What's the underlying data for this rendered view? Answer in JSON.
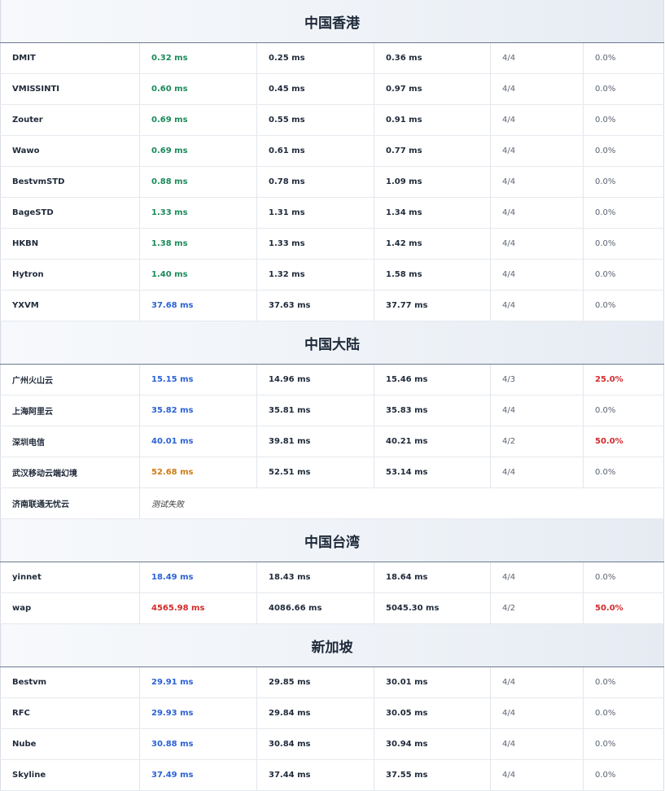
{
  "sections": [
    {
      "title": "中国香港",
      "rows": [
        {
          "name": "DMIT",
          "avg": "0.32 ms",
          "avg_color": "green",
          "min": "0.25 ms",
          "max": "0.36 ms",
          "pkts": "4/4",
          "loss": "0.0%",
          "loss_color": "normal"
        },
        {
          "name": "VMISSINTI",
          "avg": "0.60 ms",
          "avg_color": "green",
          "min": "0.45 ms",
          "max": "0.97 ms",
          "pkts": "4/4",
          "loss": "0.0%",
          "loss_color": "normal"
        },
        {
          "name": "Zouter",
          "avg": "0.69 ms",
          "avg_color": "green",
          "min": "0.55 ms",
          "max": "0.91 ms",
          "pkts": "4/4",
          "loss": "0.0%",
          "loss_color": "normal"
        },
        {
          "name": "Wawo",
          "avg": "0.69 ms",
          "avg_color": "green",
          "min": "0.61 ms",
          "max": "0.77 ms",
          "pkts": "4/4",
          "loss": "0.0%",
          "loss_color": "normal"
        },
        {
          "name": "BestvmSTD",
          "avg": "0.88 ms",
          "avg_color": "green",
          "min": "0.78 ms",
          "max": "1.09 ms",
          "pkts": "4/4",
          "loss": "0.0%",
          "loss_color": "normal"
        },
        {
          "name": "BageSTD",
          "avg": "1.33 ms",
          "avg_color": "green",
          "min": "1.31 ms",
          "max": "1.34 ms",
          "pkts": "4/4",
          "loss": "0.0%",
          "loss_color": "normal"
        },
        {
          "name": "HKBN",
          "avg": "1.38 ms",
          "avg_color": "green",
          "min": "1.33 ms",
          "max": "1.42 ms",
          "pkts": "4/4",
          "loss": "0.0%",
          "loss_color": "normal"
        },
        {
          "name": "Hytron",
          "avg": "1.40 ms",
          "avg_color": "green",
          "min": "1.32 ms",
          "max": "1.58 ms",
          "pkts": "4/4",
          "loss": "0.0%",
          "loss_color": "normal"
        },
        {
          "name": "YXVM",
          "avg": "37.68 ms",
          "avg_color": "blue",
          "min": "37.63 ms",
          "max": "37.77 ms",
          "pkts": "4/4",
          "loss": "0.0%",
          "loss_color": "normal"
        }
      ]
    },
    {
      "title": "中国大陆",
      "rows": [
        {
          "name": "广州火山云",
          "avg": "15.15 ms",
          "avg_color": "blue",
          "min": "14.96 ms",
          "max": "15.46 ms",
          "pkts": "4/3",
          "loss": "25.0%",
          "loss_color": "red"
        },
        {
          "name": "上海阿里云",
          "avg": "35.82 ms",
          "avg_color": "blue",
          "min": "35.81 ms",
          "max": "35.83 ms",
          "pkts": "4/4",
          "loss": "0.0%",
          "loss_color": "normal"
        },
        {
          "name": "深圳电信",
          "avg": "40.01 ms",
          "avg_color": "blue",
          "min": "39.81 ms",
          "max": "40.21 ms",
          "pkts": "4/2",
          "loss": "50.0%",
          "loss_color": "red"
        },
        {
          "name": "武汉移动云端幻境",
          "avg": "52.68 ms",
          "avg_color": "orange",
          "min": "52.51 ms",
          "max": "53.14 ms",
          "pkts": "4/4",
          "loss": "0.0%",
          "loss_color": "normal"
        },
        {
          "name": "济南联通无忧云",
          "fail": "测试失败"
        }
      ]
    },
    {
      "title": "中国台湾",
      "rows": [
        {
          "name": "yinnet",
          "avg": "18.49 ms",
          "avg_color": "blue",
          "min": "18.43 ms",
          "max": "18.64 ms",
          "pkts": "4/4",
          "loss": "0.0%",
          "loss_color": "normal"
        },
        {
          "name": "wap",
          "avg": "4565.98 ms",
          "avg_color": "red",
          "min": "4086.66 ms",
          "max": "5045.30 ms",
          "pkts": "4/2",
          "loss": "50.0%",
          "loss_color": "red"
        }
      ]
    },
    {
      "title": "新加坡",
      "rows": [
        {
          "name": "Bestvm",
          "avg": "29.91 ms",
          "avg_color": "blue",
          "min": "29.85 ms",
          "max": "30.01 ms",
          "pkts": "4/4",
          "loss": "0.0%",
          "loss_color": "normal"
        },
        {
          "name": "RFC",
          "avg": "29.93 ms",
          "avg_color": "blue",
          "min": "29.84 ms",
          "max": "30.05 ms",
          "pkts": "4/4",
          "loss": "0.0%",
          "loss_color": "normal"
        },
        {
          "name": "Nube",
          "avg": "30.88 ms",
          "avg_color": "blue",
          "min": "30.84 ms",
          "max": "30.94 ms",
          "pkts": "4/4",
          "loss": "0.0%",
          "loss_color": "normal"
        },
        {
          "name": "Skyline",
          "avg": "37.49 ms",
          "avg_color": "blue",
          "min": "37.44 ms",
          "max": "37.55 ms",
          "pkts": "4/4",
          "loss": "0.0%",
          "loss_color": "normal"
        }
      ]
    }
  ]
}
